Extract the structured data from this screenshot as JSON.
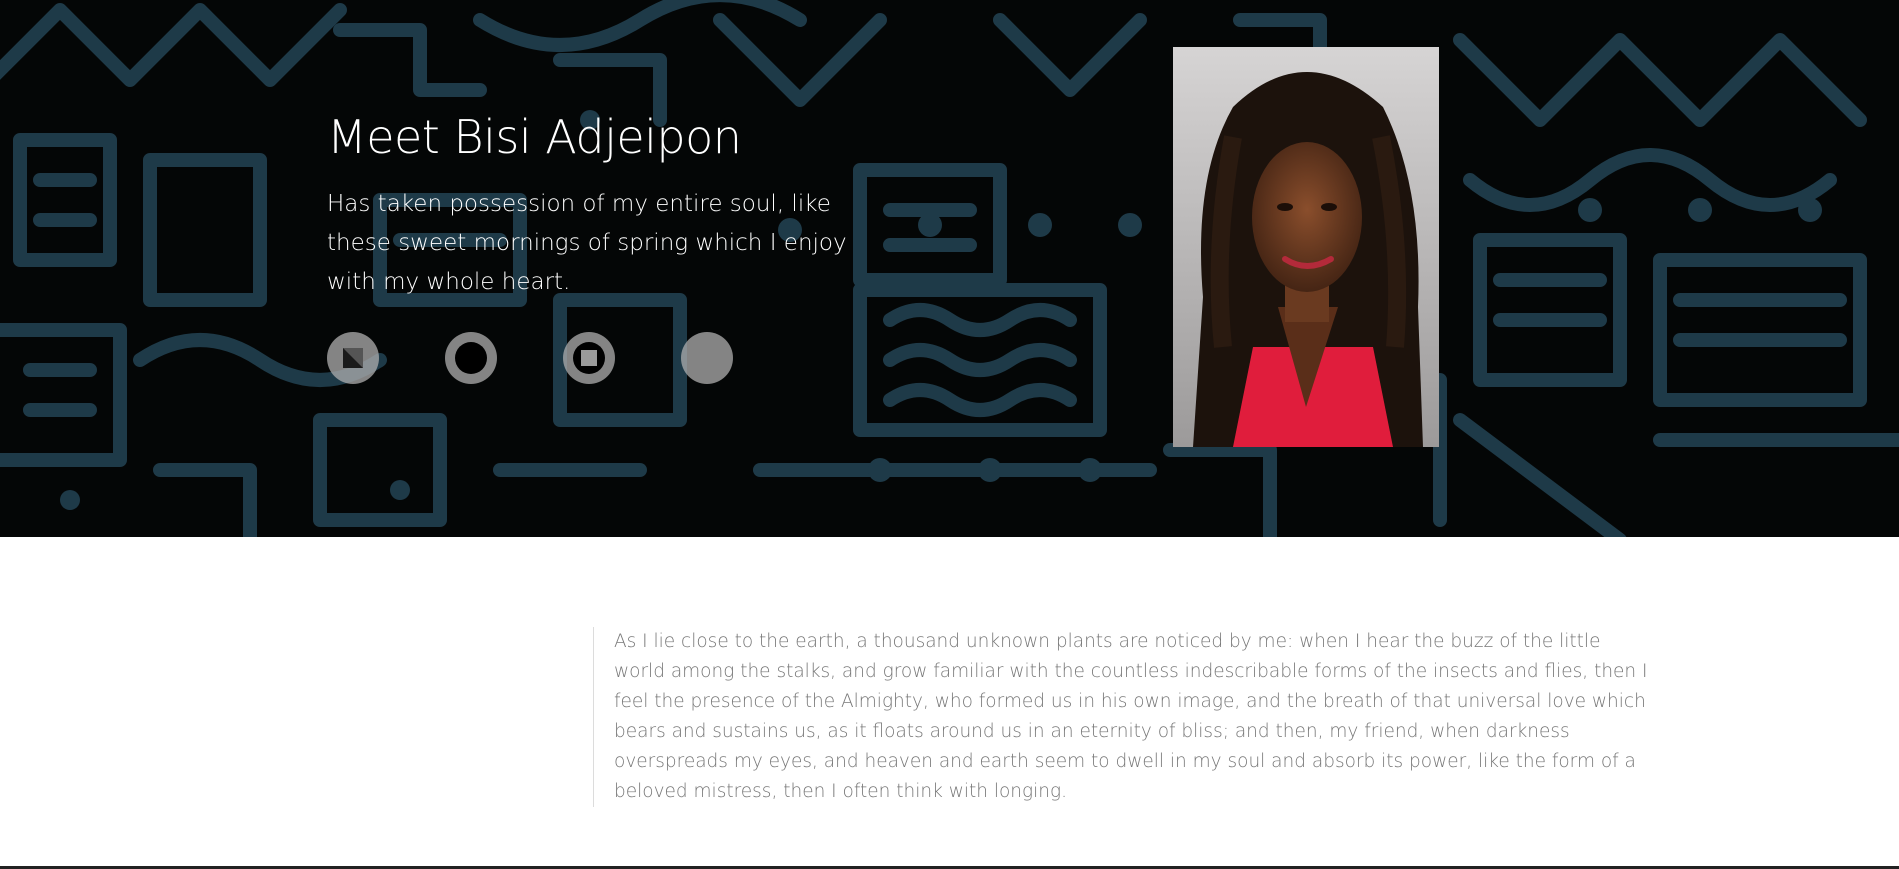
{
  "hero": {
    "title": "Meet Bisi Adjeipon",
    "subtitle": "Has taken possession of my entire soul, like these sweet mornings of spring which I enjoy with my whole heart.",
    "social_icons": [
      "square-icon",
      "circle-ring-icon",
      "square-ring-icon",
      "filled-circle-icon"
    ],
    "portrait_alt": "Portrait of Bisi Adjeipon"
  },
  "quote": {
    "text": "As I lie close to the earth, a thousand unknown plants are noticed by me: when I hear the buzz of the little world among the stalks, and grow familiar with the countless indescribable forms of the insects and flies, then I feel the presence of the Almighty, who formed us in his own image, and the breath of that universal love which bears and sustains us, as it floats around us in an eternity of bliss; and then, my friend, when darkness overspreads my eyes, and heaven and earth seem to dwell in my soul and absorb its power, like the form of a beloved mistress, then I often think with longing."
  },
  "colors": {
    "pattern": "#1e3a48",
    "background": "#040606",
    "portrait_dress": "#e01d3c",
    "icon_bg": "#afafaf"
  }
}
